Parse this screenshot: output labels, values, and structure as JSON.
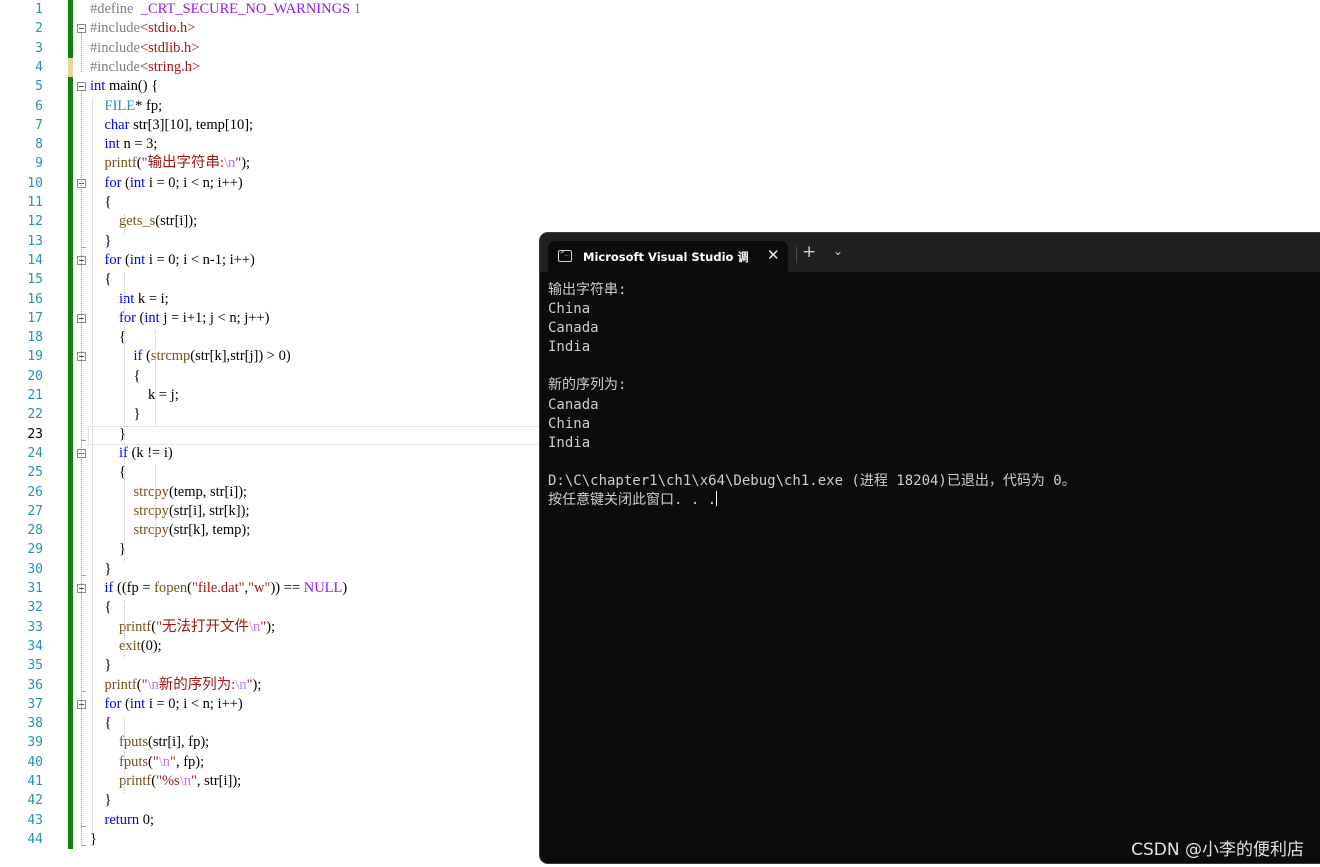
{
  "editor": {
    "current_line_number": 23,
    "lines": [
      [
        {
          "c": "pp",
          "t": "#define  "
        },
        {
          "c": "mac",
          "t": "_CRT_SECURE_NO_WARNINGS"
        },
        {
          "c": "pp",
          "t": " 1"
        }
      ],
      [
        {
          "c": "pp",
          "t": "#include"
        },
        {
          "c": "str",
          "t": "<stdio.h>"
        }
      ],
      [
        {
          "c": "pp",
          "t": "#include"
        },
        {
          "c": "str",
          "t": "<stdlib.h>"
        }
      ],
      [
        {
          "c": "pp",
          "t": "#include"
        },
        {
          "c": "str",
          "t": "<string.h>"
        }
      ],
      [
        {
          "c": "kw",
          "t": "int"
        },
        {
          "t": " main() {"
        }
      ],
      [
        {
          "t": "    "
        },
        {
          "c": "ty",
          "t": "FILE"
        },
        {
          "t": "* fp;"
        }
      ],
      [
        {
          "t": "    "
        },
        {
          "c": "kw",
          "t": "char"
        },
        {
          "t": " str[3][10], temp[10];"
        }
      ],
      [
        {
          "t": "    "
        },
        {
          "c": "kw",
          "t": "int"
        },
        {
          "t": " n = 3;"
        }
      ],
      [
        {
          "t": "    "
        },
        {
          "c": "fn",
          "t": "printf"
        },
        {
          "t": "("
        },
        {
          "c": "str",
          "t": "\"输出字符串:"
        },
        {
          "c": "esc",
          "t": "\\n"
        },
        {
          "c": "str",
          "t": "\""
        },
        {
          "t": ");"
        }
      ],
      [
        {
          "t": "    "
        },
        {
          "c": "kw",
          "t": "for"
        },
        {
          "t": " ("
        },
        {
          "c": "kw",
          "t": "int"
        },
        {
          "t": " i = 0; i < n; i++)"
        }
      ],
      [
        {
          "t": "    {"
        }
      ],
      [
        {
          "t": "        "
        },
        {
          "c": "fn",
          "t": "gets_s"
        },
        {
          "t": "(str[i]);"
        }
      ],
      [
        {
          "t": "    }"
        }
      ],
      [
        {
          "t": "    "
        },
        {
          "c": "kw",
          "t": "for"
        },
        {
          "t": " ("
        },
        {
          "c": "kw",
          "t": "int"
        },
        {
          "t": " i = 0; i < n-1; i++)"
        }
      ],
      [
        {
          "t": "    {"
        }
      ],
      [
        {
          "t": "        "
        },
        {
          "c": "kw",
          "t": "int"
        },
        {
          "t": " k = i;"
        }
      ],
      [
        {
          "t": "        "
        },
        {
          "c": "kw",
          "t": "for"
        },
        {
          "t": " ("
        },
        {
          "c": "kw",
          "t": "int"
        },
        {
          "t": " j = i+1; j < n; j++)"
        }
      ],
      [
        {
          "t": "        {"
        }
      ],
      [
        {
          "t": "            "
        },
        {
          "c": "kw",
          "t": "if"
        },
        {
          "t": " ("
        },
        {
          "c": "fn",
          "t": "strcmp"
        },
        {
          "t": "(str[k],str[j]) > 0)"
        }
      ],
      [
        {
          "t": "            {"
        }
      ],
      [
        {
          "t": "                k = j;"
        }
      ],
      [
        {
          "t": "            }"
        }
      ],
      [
        {
          "t": "        }"
        }
      ],
      [
        {
          "t": "        "
        },
        {
          "c": "kw",
          "t": "if"
        },
        {
          "t": " (k != i)"
        }
      ],
      [
        {
          "t": "        {"
        }
      ],
      [
        {
          "t": "            "
        },
        {
          "c": "fn",
          "t": "strcpy"
        },
        {
          "t": "(temp, str[i]);"
        }
      ],
      [
        {
          "t": "            "
        },
        {
          "c": "fn",
          "t": "strcpy"
        },
        {
          "t": "(str[i], str[k]);"
        }
      ],
      [
        {
          "t": "            "
        },
        {
          "c": "fn",
          "t": "strcpy"
        },
        {
          "t": "(str[k], temp);"
        }
      ],
      [
        {
          "t": "        }"
        }
      ],
      [
        {
          "t": "    }"
        }
      ],
      [
        {
          "t": "    "
        },
        {
          "c": "kw",
          "t": "if"
        },
        {
          "t": " ((fp = "
        },
        {
          "c": "fn",
          "t": "fopen"
        },
        {
          "t": "("
        },
        {
          "c": "str",
          "t": "\"file.dat\""
        },
        {
          "t": ","
        },
        {
          "c": "str",
          "t": "\"w\""
        },
        {
          "t": ")) == "
        },
        {
          "c": "mac",
          "t": "NULL"
        },
        {
          "t": ")"
        }
      ],
      [
        {
          "t": "    {"
        }
      ],
      [
        {
          "t": "        "
        },
        {
          "c": "fn",
          "t": "printf"
        },
        {
          "t": "("
        },
        {
          "c": "str",
          "t": "\"无法打开文件"
        },
        {
          "c": "esc",
          "t": "\\n"
        },
        {
          "c": "str",
          "t": "\""
        },
        {
          "t": ");"
        }
      ],
      [
        {
          "t": "        "
        },
        {
          "c": "fn",
          "t": "exit"
        },
        {
          "t": "(0);"
        }
      ],
      [
        {
          "t": "    }"
        }
      ],
      [
        {
          "t": "    "
        },
        {
          "c": "fn",
          "t": "printf"
        },
        {
          "t": "("
        },
        {
          "c": "str",
          "t": "\""
        },
        {
          "c": "esc",
          "t": "\\n"
        },
        {
          "c": "str",
          "t": "新的序列为:"
        },
        {
          "c": "esc",
          "t": "\\n"
        },
        {
          "c": "str",
          "t": "\""
        },
        {
          "t": ");"
        }
      ],
      [
        {
          "t": "    "
        },
        {
          "c": "kw",
          "t": "for"
        },
        {
          "t": " ("
        },
        {
          "c": "kw",
          "t": "int"
        },
        {
          "t": " i = 0; i < n; i++)"
        }
      ],
      [
        {
          "t": "    {"
        }
      ],
      [
        {
          "t": "        "
        },
        {
          "c": "fn",
          "t": "fputs"
        },
        {
          "t": "(str[i], fp);"
        }
      ],
      [
        {
          "t": "        "
        },
        {
          "c": "fn",
          "t": "fputs"
        },
        {
          "t": "("
        },
        {
          "c": "str",
          "t": "\""
        },
        {
          "c": "esc",
          "t": "\\n"
        },
        {
          "c": "str",
          "t": "\""
        },
        {
          "t": ", fp);"
        }
      ],
      [
        {
          "t": "        "
        },
        {
          "c": "fn",
          "t": "printf"
        },
        {
          "t": "("
        },
        {
          "c": "str",
          "t": "\"%s"
        },
        {
          "c": "esc",
          "t": "\\n"
        },
        {
          "c": "str",
          "t": "\""
        },
        {
          "t": ", str[i]);"
        }
      ],
      [
        {
          "t": "    }"
        }
      ],
      [
        {
          "t": "    "
        },
        {
          "c": "kw",
          "t": "return"
        },
        {
          "t": " 0;"
        }
      ],
      [
        {
          "t": "}"
        }
      ]
    ]
  },
  "terminal": {
    "tab_title": "Microsoft Visual Studio 调试控制台",
    "tab_icon": "terminal-icon",
    "close_glyph": "✕",
    "new_tab_glyph": "+",
    "dropdown_glyph": "⌄",
    "output": [
      "输出字符串:",
      "China",
      "Canada",
      "India",
      "",
      "新的序列为:",
      "Canada",
      "China",
      "India",
      "",
      "D:\\C\\chapter1\\ch1\\x64\\Debug\\ch1.exe (进程 18204)已退出，代码为 0。",
      "按任意键关闭此窗口. . ."
    ]
  },
  "watermark": "CSDN @小李的便利店",
  "colors": {
    "keyword": "#0000ff",
    "type": "#2b91af",
    "string": "#a31515",
    "escape": "#b776fb",
    "terminal_bg": "#0c0c0c"
  }
}
